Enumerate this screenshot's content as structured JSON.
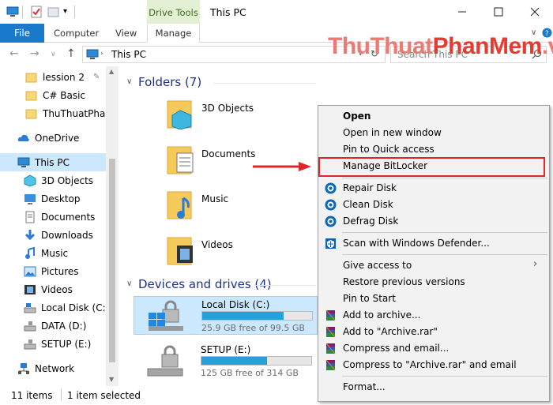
{
  "ribbon": {
    "context_tab": "Drive Tools",
    "window_title": "This PC",
    "tabs": [
      "File",
      "Computer",
      "View",
      "Manage"
    ]
  },
  "navigation": {
    "address": "This PC",
    "search_placeholder": "Search This PC"
  },
  "watermark": {
    "part1": "ThuThuat",
    "part2": "PhanMem",
    "part3": ".vn"
  },
  "sidebar": {
    "items": [
      {
        "label": "lession 2",
        "icon": "folder-icon"
      },
      {
        "label": "C# Basic",
        "icon": "folder-icon"
      },
      {
        "label": "ThuThuatPhanM",
        "icon": "folder-icon"
      },
      {
        "label": "OneDrive",
        "icon": "cloud-icon"
      },
      {
        "label": "This PC",
        "icon": "computer-icon",
        "selected": true
      },
      {
        "label": "3D Objects",
        "icon": "cube-icon"
      },
      {
        "label": "Desktop",
        "icon": "desktop-icon"
      },
      {
        "label": "Documents",
        "icon": "document-icon"
      },
      {
        "label": "Downloads",
        "icon": "download-icon"
      },
      {
        "label": "Music",
        "icon": "music-icon"
      },
      {
        "label": "Pictures",
        "icon": "pictures-icon"
      },
      {
        "label": "Videos",
        "icon": "videos-icon"
      },
      {
        "label": "Local Disk (C:)",
        "icon": "drive-icon"
      },
      {
        "label": "DATA (D:)",
        "icon": "drive-icon"
      },
      {
        "label": "SETUP (E:)",
        "icon": "drive-icon"
      },
      {
        "label": "Network",
        "icon": "network-icon"
      }
    ]
  },
  "main": {
    "folders_header": "Folders (7)",
    "folders": [
      "3D Objects",
      "Documents",
      "Music",
      "Videos"
    ],
    "devices_header": "Devices and drives (4)",
    "drives": [
      {
        "name": "Local Disk (C:)",
        "free": "25.9 GB free of 99.5 GB",
        "used_fraction": 0.74
      },
      {
        "name": "SETUP (E:)",
        "free": "125 GB free of 314 GB",
        "used_fraction": 0.6
      }
    ]
  },
  "status": {
    "items": "11 items",
    "selected": "1 item selected"
  },
  "context_menu": {
    "items": [
      {
        "label": "Open",
        "bold": true
      },
      {
        "label": "Open in new window"
      },
      {
        "label": "Pin to Quick access"
      },
      {
        "label": "Manage BitLocker",
        "highlighted": true
      },
      {
        "label": "Repair Disk",
        "icon": "disk-tool-icon"
      },
      {
        "label": "Clean Disk",
        "icon": "disk-tool-icon"
      },
      {
        "label": "Defrag Disk",
        "icon": "disk-tool-icon"
      },
      {
        "label": "Scan with Windows Defender...",
        "icon": "defender-icon"
      },
      {
        "label": "Give access to",
        "submenu": true
      },
      {
        "label": "Restore previous versions"
      },
      {
        "label": "Pin to Start"
      },
      {
        "label": "Add to archive...",
        "icon": "winrar-icon"
      },
      {
        "label": "Add to \"Archive.rar\"",
        "icon": "winrar-icon"
      },
      {
        "label": "Compress and email...",
        "icon": "winrar-icon"
      },
      {
        "label": "Compress to \"Archive.rar\" and email",
        "icon": "winrar-icon"
      },
      {
        "label": "Format..."
      }
    ]
  },
  "colors": {
    "file_tab": "#1979ca",
    "selection": "#cce8ff",
    "progress": "#26a0da",
    "highlight_box": "#e0262b",
    "section_header": "#1e3287"
  }
}
